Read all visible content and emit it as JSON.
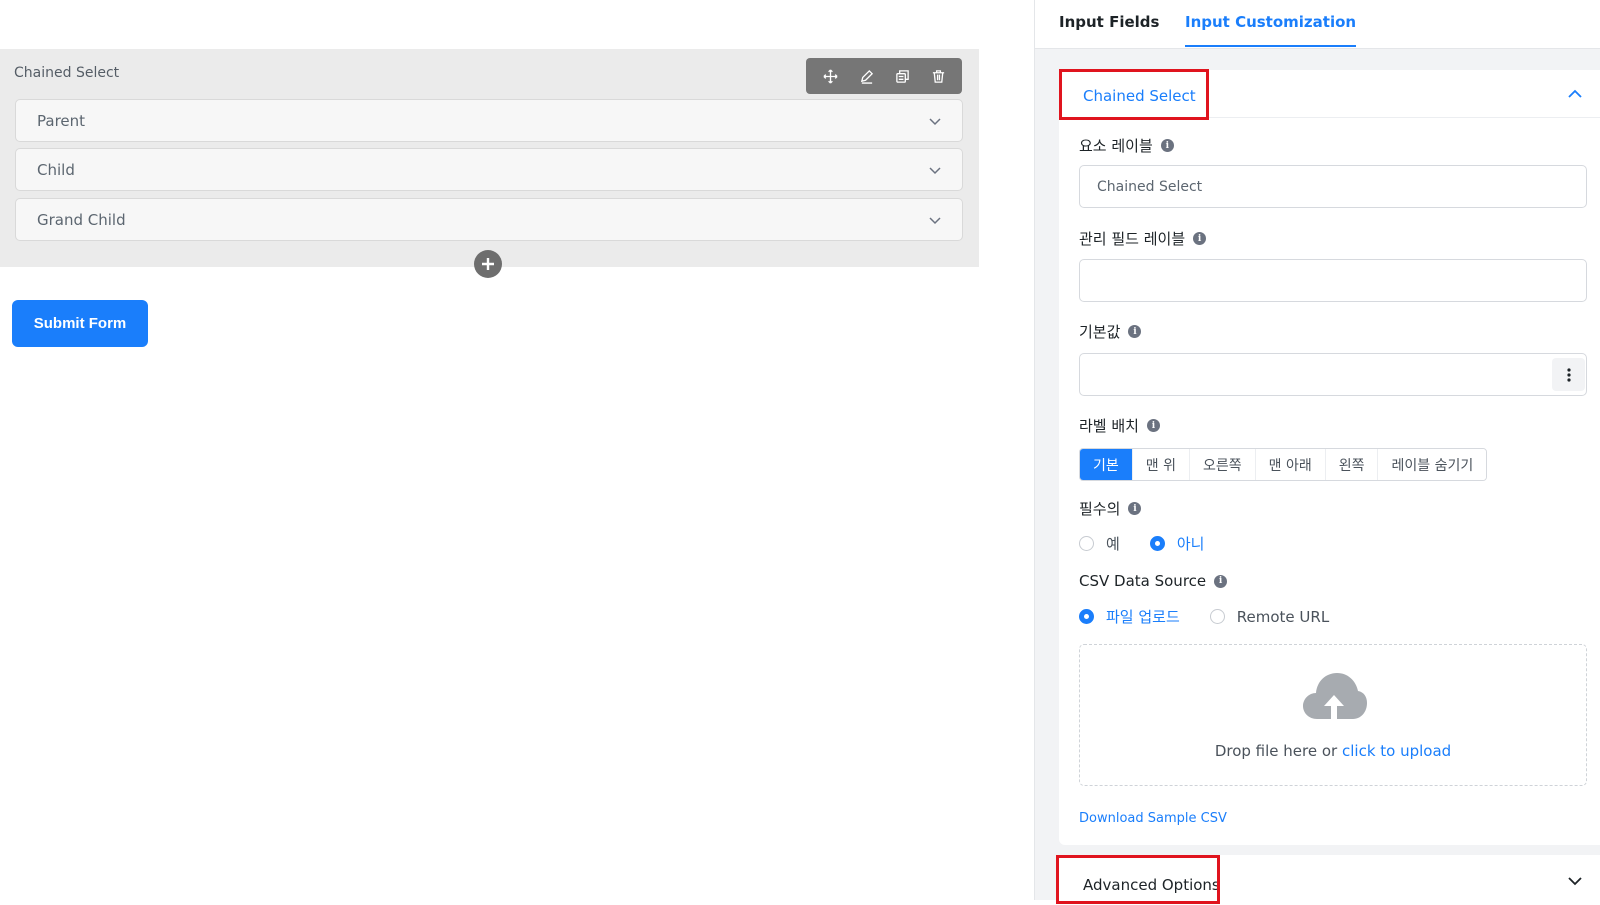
{
  "canvas": {
    "field_title": "Chained Select",
    "selects": [
      {
        "value": "Parent"
      },
      {
        "value": "Child"
      },
      {
        "value": "Grand Child"
      }
    ],
    "toolbar_icons": [
      "move-icon",
      "edit-icon",
      "duplicate-icon",
      "trash-icon"
    ],
    "submit_label": "Submit Form"
  },
  "panel": {
    "tabs": [
      {
        "label": "Input Fields",
        "active": false
      },
      {
        "label": "Input Customization",
        "active": true
      }
    ],
    "section_title": "Chained Select",
    "element_label": {
      "label": "요소 레이블",
      "value": "Chained Select"
    },
    "admin_label": {
      "label": "관리 필드 레이블",
      "value": ""
    },
    "default_value": {
      "label": "기본값",
      "value": ""
    },
    "label_placement": {
      "label": "라벨 배치",
      "options": [
        "기본",
        "맨 위",
        "오른쪽",
        "맨 아래",
        "왼쪽",
        "레이블 숨기기"
      ],
      "selected": "기본"
    },
    "required": {
      "label": "필수의",
      "options": [
        "예",
        "아니"
      ],
      "selected": "아니"
    },
    "csv_source": {
      "label": "CSV Data Source",
      "options": [
        "파일 업로드",
        "Remote URL"
      ],
      "selected": "파일 업로드"
    },
    "dropzone": {
      "text": "Drop file here or",
      "link": "click to upload"
    },
    "sample_csv": "Download Sample CSV",
    "advanced_title": "Advanced Options"
  },
  "colors": {
    "accent": "#1a7efb",
    "highlight": "#e0141e"
  }
}
